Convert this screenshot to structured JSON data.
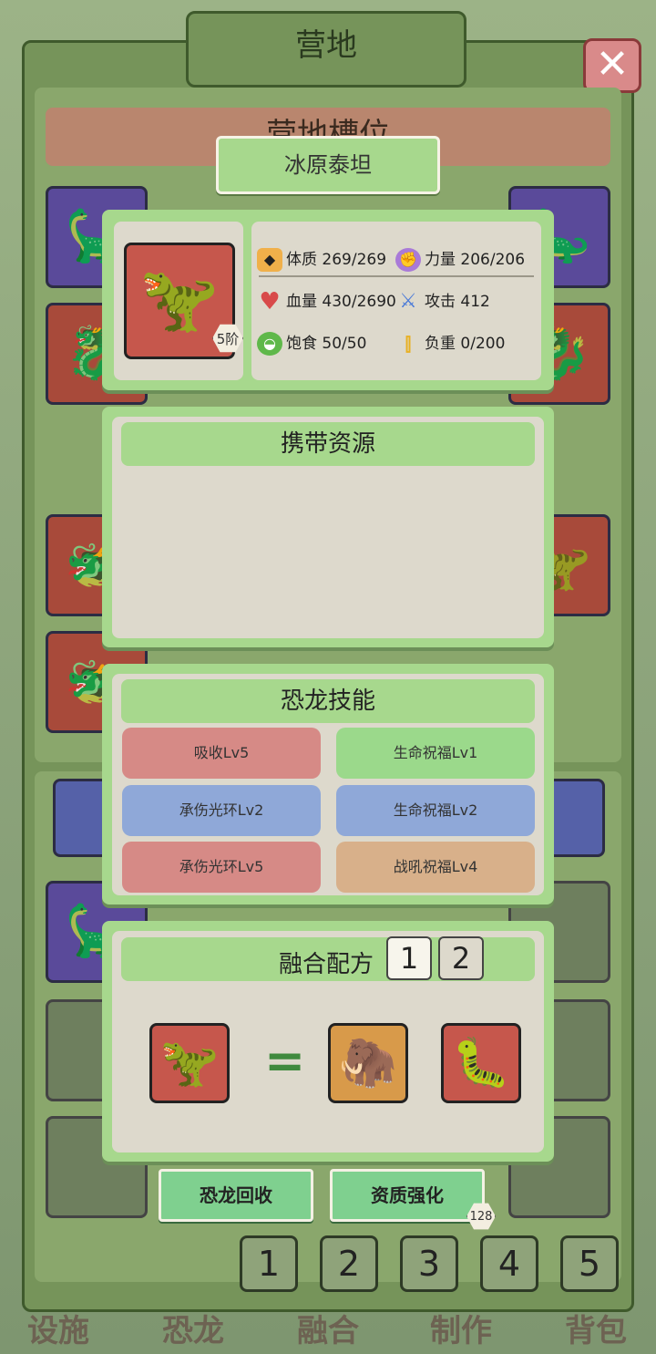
{
  "background": {
    "camp_title": "营地",
    "slot_header": "营地槽位",
    "page_buttons": [
      "1",
      "2",
      "3",
      "4",
      "5"
    ],
    "tabs": [
      "设施",
      "恐龙",
      "融合",
      "制作",
      "背包"
    ]
  },
  "dino": {
    "name": "冰原泰坦",
    "portrait_icon": "ice-dinosaur",
    "rank": "5阶"
  },
  "stats": {
    "constitution": {
      "label": "体质",
      "value": "269/269"
    },
    "strength": {
      "label": "力量",
      "value": "206/206"
    },
    "hp": {
      "label": "血量",
      "value": "430/2690"
    },
    "attack": {
      "label": "攻击",
      "value": "412"
    },
    "satiety": {
      "label": "饱食",
      "value": "50/50"
    },
    "load": {
      "label": "负重",
      "value": "0/200"
    }
  },
  "resources": {
    "title": "携带资源"
  },
  "skills": {
    "title": "恐龙技能",
    "items": [
      {
        "label": "吸收Lv5",
        "color": "#d68a86"
      },
      {
        "label": "生命祝福Lv1",
        "color": "#9bd98b"
      },
      {
        "label": "承伤光环Lv2",
        "color": "#8fa8d8"
      },
      {
        "label": "生命祝福Lv2",
        "color": "#8fa8d8"
      },
      {
        "label": "承伤光环Lv5",
        "color": "#d68a86"
      },
      {
        "label": "战吼祝福Lv4",
        "color": "#d8b08a"
      }
    ]
  },
  "fusion": {
    "title": "融合配方",
    "recipe_tabs": [
      "1",
      "2"
    ],
    "active_recipe": "1",
    "result_icon": "ice-dinosaur",
    "ingredients": [
      "mammoth",
      "centipede"
    ]
  },
  "actions": {
    "recycle_label": "恐龙回收",
    "enhance_label": "资质强化",
    "enhance_cost": "128"
  },
  "colors": {
    "panel_green": "#a7d88d",
    "panel_beige": "#ddd9cc",
    "action_green": "#7fd08f"
  }
}
